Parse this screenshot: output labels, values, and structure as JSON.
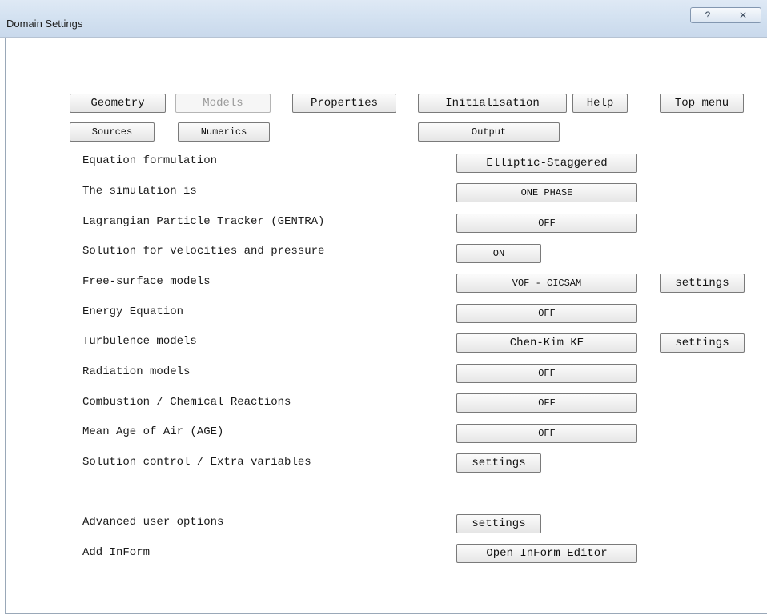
{
  "window": {
    "title": "Domain Settings",
    "help_glyph": "?",
    "close_glyph": "✕"
  },
  "nav": {
    "geometry": "Geometry",
    "models": "Models",
    "properties": "Properties",
    "initialisation": "Initialisation",
    "help": "Help",
    "top_menu": "Top menu",
    "sources": "Sources",
    "numerics": "Numerics",
    "output": "Output"
  },
  "rows": [
    {
      "label": "Equation formulation",
      "value": "Elliptic-Staggered"
    },
    {
      "label": "The simulation is",
      "value": "ONE PHASE"
    },
    {
      "label": "Lagrangian Particle Tracker (GENTRA)",
      "value": "OFF"
    },
    {
      "label": "Solution for velocities and pressure",
      "value": "ON"
    },
    {
      "label": "Free-surface models",
      "value": "VOF - CICSAM",
      "extra": "settings"
    },
    {
      "label": "Energy Equation",
      "value": "OFF"
    },
    {
      "label": "Turbulence models",
      "value": "Chen-Kim KE",
      "extra": "settings"
    },
    {
      "label": "Radiation models",
      "value": "OFF"
    },
    {
      "label": "Combustion / Chemical Reactions",
      "value": "OFF"
    },
    {
      "label": "Mean Age of Air (AGE)",
      "value": "OFF"
    },
    {
      "label": "Solution control / Extra variables",
      "value": "settings"
    },
    {
      "label": "Advanced user options",
      "value": "settings"
    },
    {
      "label": "Add InForm",
      "value": "Open InForm Editor"
    }
  ]
}
